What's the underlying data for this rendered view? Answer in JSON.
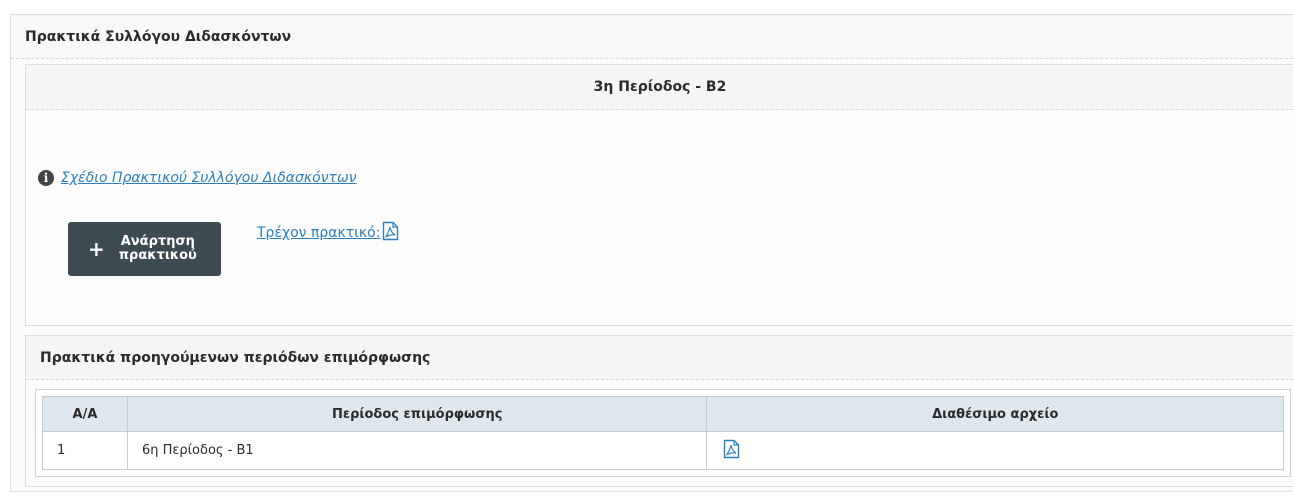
{
  "panel": {
    "title": "Πρακτικά Συλλόγου Διδασκόντων"
  },
  "period": {
    "title": "3η Περίοδος - Β2",
    "template_link": "Σχέδιο Πρακτικού Συλλόγου Διδασκόντων",
    "upload_button": {
      "line1": "Ανάρτηση",
      "line2": "πρακτικού"
    },
    "current_label": "Τρέχον πρακτικό:"
  },
  "previous": {
    "title": "Πρακτικά προηγούμενων περιόδων επιμόρφωσης",
    "columns": [
      "Α/Α",
      "Περίοδος επιμόρφωσης",
      "Διαθέσιμο αρχείο"
    ],
    "rows": [
      {
        "index": "1",
        "period": "6η Περίοδος - Β1",
        "file_icon": "pdf-icon"
      }
    ]
  },
  "colors": {
    "link": "#2a7fc1",
    "button": "#3b4b51",
    "table_header": "#dfe7ee"
  }
}
